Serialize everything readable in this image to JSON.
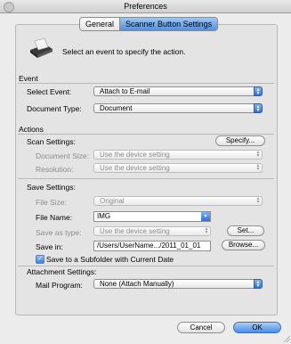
{
  "window": {
    "title": "Preferences"
  },
  "tabs": [
    {
      "label": "General",
      "active": false
    },
    {
      "label": "Scanner Button Settings",
      "active": true
    }
  ],
  "intro": {
    "text": "Select an event to specify the action.",
    "icon": "scanner-icon"
  },
  "event": {
    "section_label": "Event",
    "select_event_label": "Select Event:",
    "select_event_value": "Attach to E-mail",
    "document_type_label": "Document Type:",
    "document_type_value": "Document"
  },
  "actions": {
    "section_label": "Actions",
    "scan_settings_label": "Scan Settings:",
    "specify_button": "Specify...",
    "document_size_label": "Document Size:",
    "document_size_value": "Use the device setting",
    "resolution_label": "Resolution:",
    "resolution_value": "Use the device setting",
    "save_settings_label": "Save Settings:",
    "file_size_label": "File Size:",
    "file_size_value": "Original",
    "file_name_label": "File Name:",
    "file_name_value": "IMG",
    "save_as_type_label": "Save as type:",
    "save_as_type_value": "Use the device setting",
    "set_button": "Set...",
    "save_in_label": "Save in:",
    "save_in_value": "/Users/UserName.../2011_01_01",
    "browse_button": "Browse...",
    "subfolder_checkbox_label": "Save to a Subfolder with Current Date",
    "subfolder_checked": true,
    "attachment_settings_label": "Attachment Settings:",
    "mail_program_label": "Mail Program:",
    "mail_program_value": "None (Attach Manually)"
  },
  "footer": {
    "cancel_button": "Cancel",
    "ok_button": "OK"
  }
}
